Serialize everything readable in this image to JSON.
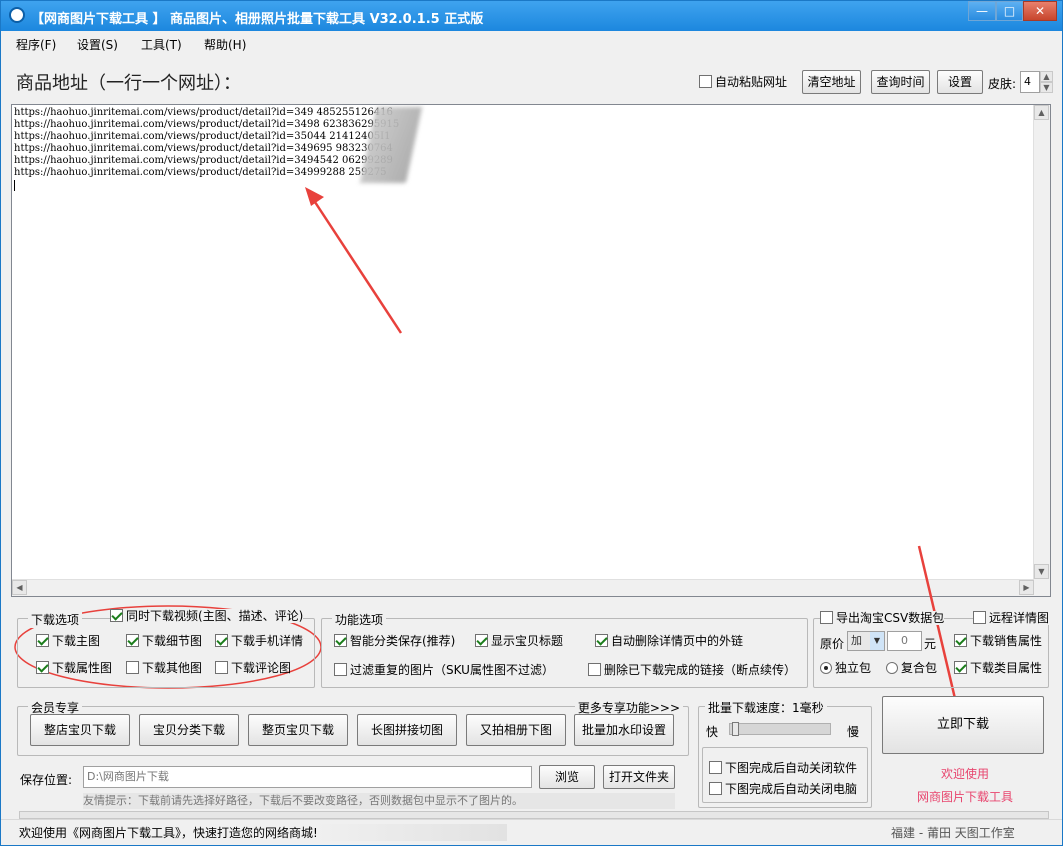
{
  "window": {
    "title": "【网商图片下载工具 】 商品图片、相册照片批量下载工具 V32.0.1.5 正式版",
    "min": "—",
    "max": "□",
    "close": "✕"
  },
  "menu": [
    "程序(F)",
    "设置(S)",
    "工具(T)",
    "帮助(H)"
  ],
  "header": {
    "label": "商品地址（一行一个网址）：",
    "auto_paste": "自动粘贴网址",
    "clear": "清空地址",
    "query_time": "查询时间",
    "settings": "设置",
    "skin_label": "皮肤:",
    "skin_value": "4"
  },
  "urls": [
    "https://haohuo.jinritemai.com/views/product/detail?id=349  485255126416",
    "https://haohuo.jinritemai.com/views/product/detail?id=3498  623836295915",
    "https://haohuo.jinritemai.com/views/product/detail?id=35044  21412405I1",
    "https://haohuo.jinritemai.com/views/product/detail?id=349695  983230764",
    "https://haohuo.jinritemai.com/views/product/detail?id=3494542  06299289",
    "https://haohuo.jinritemai.com/views/product/detail?id=34999288  259275"
  ],
  "download_options": {
    "title": "下载选项",
    "video": "同时下载视频(主图、描述、评论)",
    "main": "下载主图",
    "detail": "下载细节图",
    "mobile": "下载手机详情",
    "attr": "下载属性图",
    "other": "下载其他图",
    "review": "下载评论图"
  },
  "func_options": {
    "title": "功能选项",
    "smart": "智能分类保存(推荐)",
    "show_title": "显示宝贝标题",
    "auto_del": "自动删除详情页中的外链",
    "filter": "过滤重复的图片（SKU属性图不过滤）",
    "del_done": "删除已下载完成的链接（断点续传）"
  },
  "csv": {
    "export": "导出淘宝CSV数据包",
    "remote": "远程详情图",
    "price_label": "原价",
    "price_op": "加",
    "price_val": "0",
    "unit": "元",
    "sales_attr": "下载销售属性",
    "single": "独立包",
    "multi": "复合包",
    "class_attr": "下载类目属性"
  },
  "member": {
    "title": "会员专享",
    "more": "更多专享功能>>>",
    "buttons": [
      "整店宝贝下载",
      "宝贝分类下载",
      "整页宝贝下载",
      "长图拼接切图",
      "又拍相册下图",
      "批量加水印设置"
    ]
  },
  "speed": {
    "title": "批量下载速度：1毫秒",
    "fast": "快",
    "slow": "慢",
    "level": 0.02,
    "close_app": "下图完成后自动关闭软件",
    "shutdown": "下图完成后自动关闭电脑"
  },
  "start": {
    "button": "立即下载",
    "welcome1": "欢迎使用",
    "welcome2": "网商图片下载工具"
  },
  "save": {
    "label": "保存位置:",
    "path": "D:\\网商图片下载",
    "browse": "浏览",
    "open": "打开文件夹",
    "tip": "友情提示：下载前请先选择好路径，下载后不要改变路径，否则数据包中显示不了图片的。"
  },
  "status": {
    "left": "欢迎使用《网商图片下载工具》，快速打造您的网络商城!",
    "right": "福建 - 莆田 天图工作室"
  },
  "colors": {
    "title_bar": "#1c87de",
    "annotation_red": "#e8413c",
    "pink_text": "#e8456e"
  }
}
